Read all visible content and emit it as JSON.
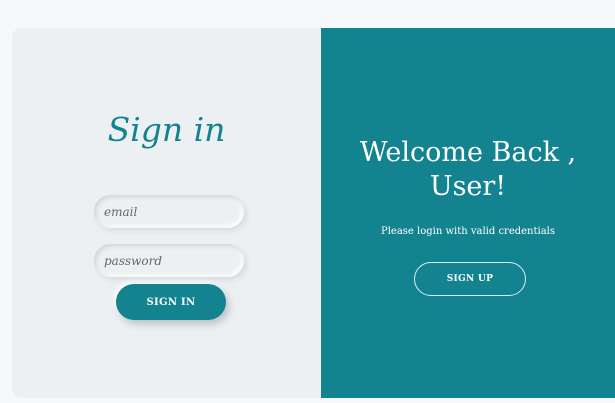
{
  "signin": {
    "title": "Sign in",
    "email_placeholder": "email",
    "password_placeholder": "password",
    "button_label": "SIGN IN"
  },
  "welcome": {
    "heading_line1": "Welcome Back ,",
    "heading_line2": "User!",
    "subtitle": "Please login with valid credentials",
    "signup_label": "SIGN UP"
  },
  "colors": {
    "accent": "#138390",
    "panel_bg": "#ecf0f3"
  }
}
